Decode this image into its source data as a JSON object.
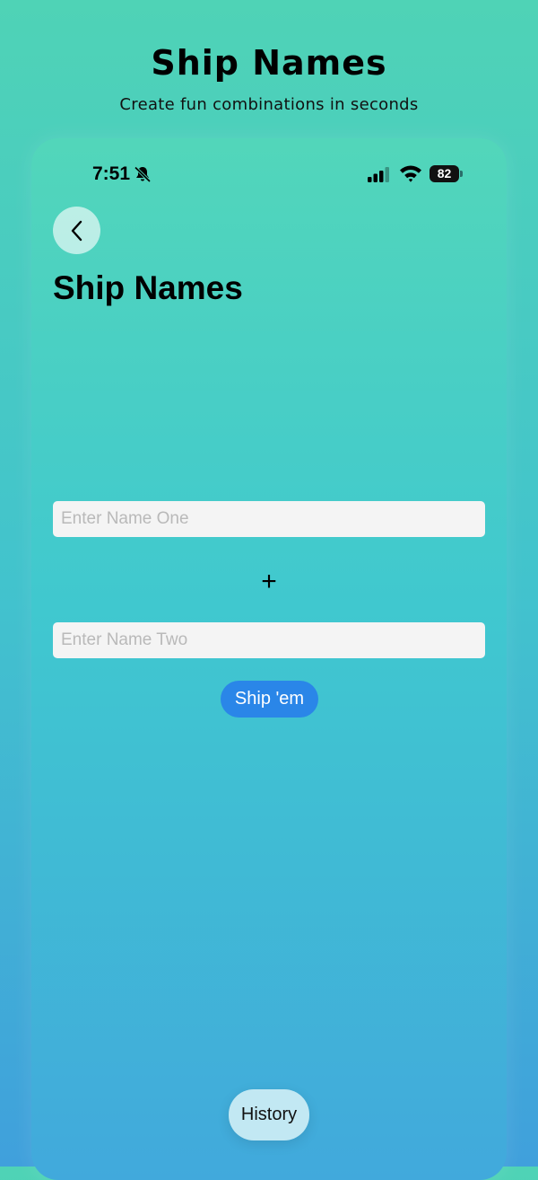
{
  "header": {
    "title": "Ship Names",
    "subtitle": "Create fun combinations in seconds"
  },
  "status_bar": {
    "time": "7:51",
    "battery_level": "82",
    "icons": [
      "bell-slash-icon",
      "signal-icon",
      "wifi-icon",
      "battery-icon"
    ]
  },
  "screen": {
    "back_icon": "chevron-left-icon",
    "title": "Ship Names",
    "name_one_placeholder": "Enter Name One",
    "name_one_value": "",
    "plus": "+",
    "name_two_placeholder": "Enter Name Two",
    "name_two_value": "",
    "ship_button_label": "Ship 'em",
    "history_button_label": "History"
  },
  "colors": {
    "background_top": "#4fd3b6",
    "background_bottom": "#40a0dc",
    "primary_button": "#2a86e8",
    "input_background": "#f4f4f4",
    "history_button": "#c2e8f3"
  }
}
